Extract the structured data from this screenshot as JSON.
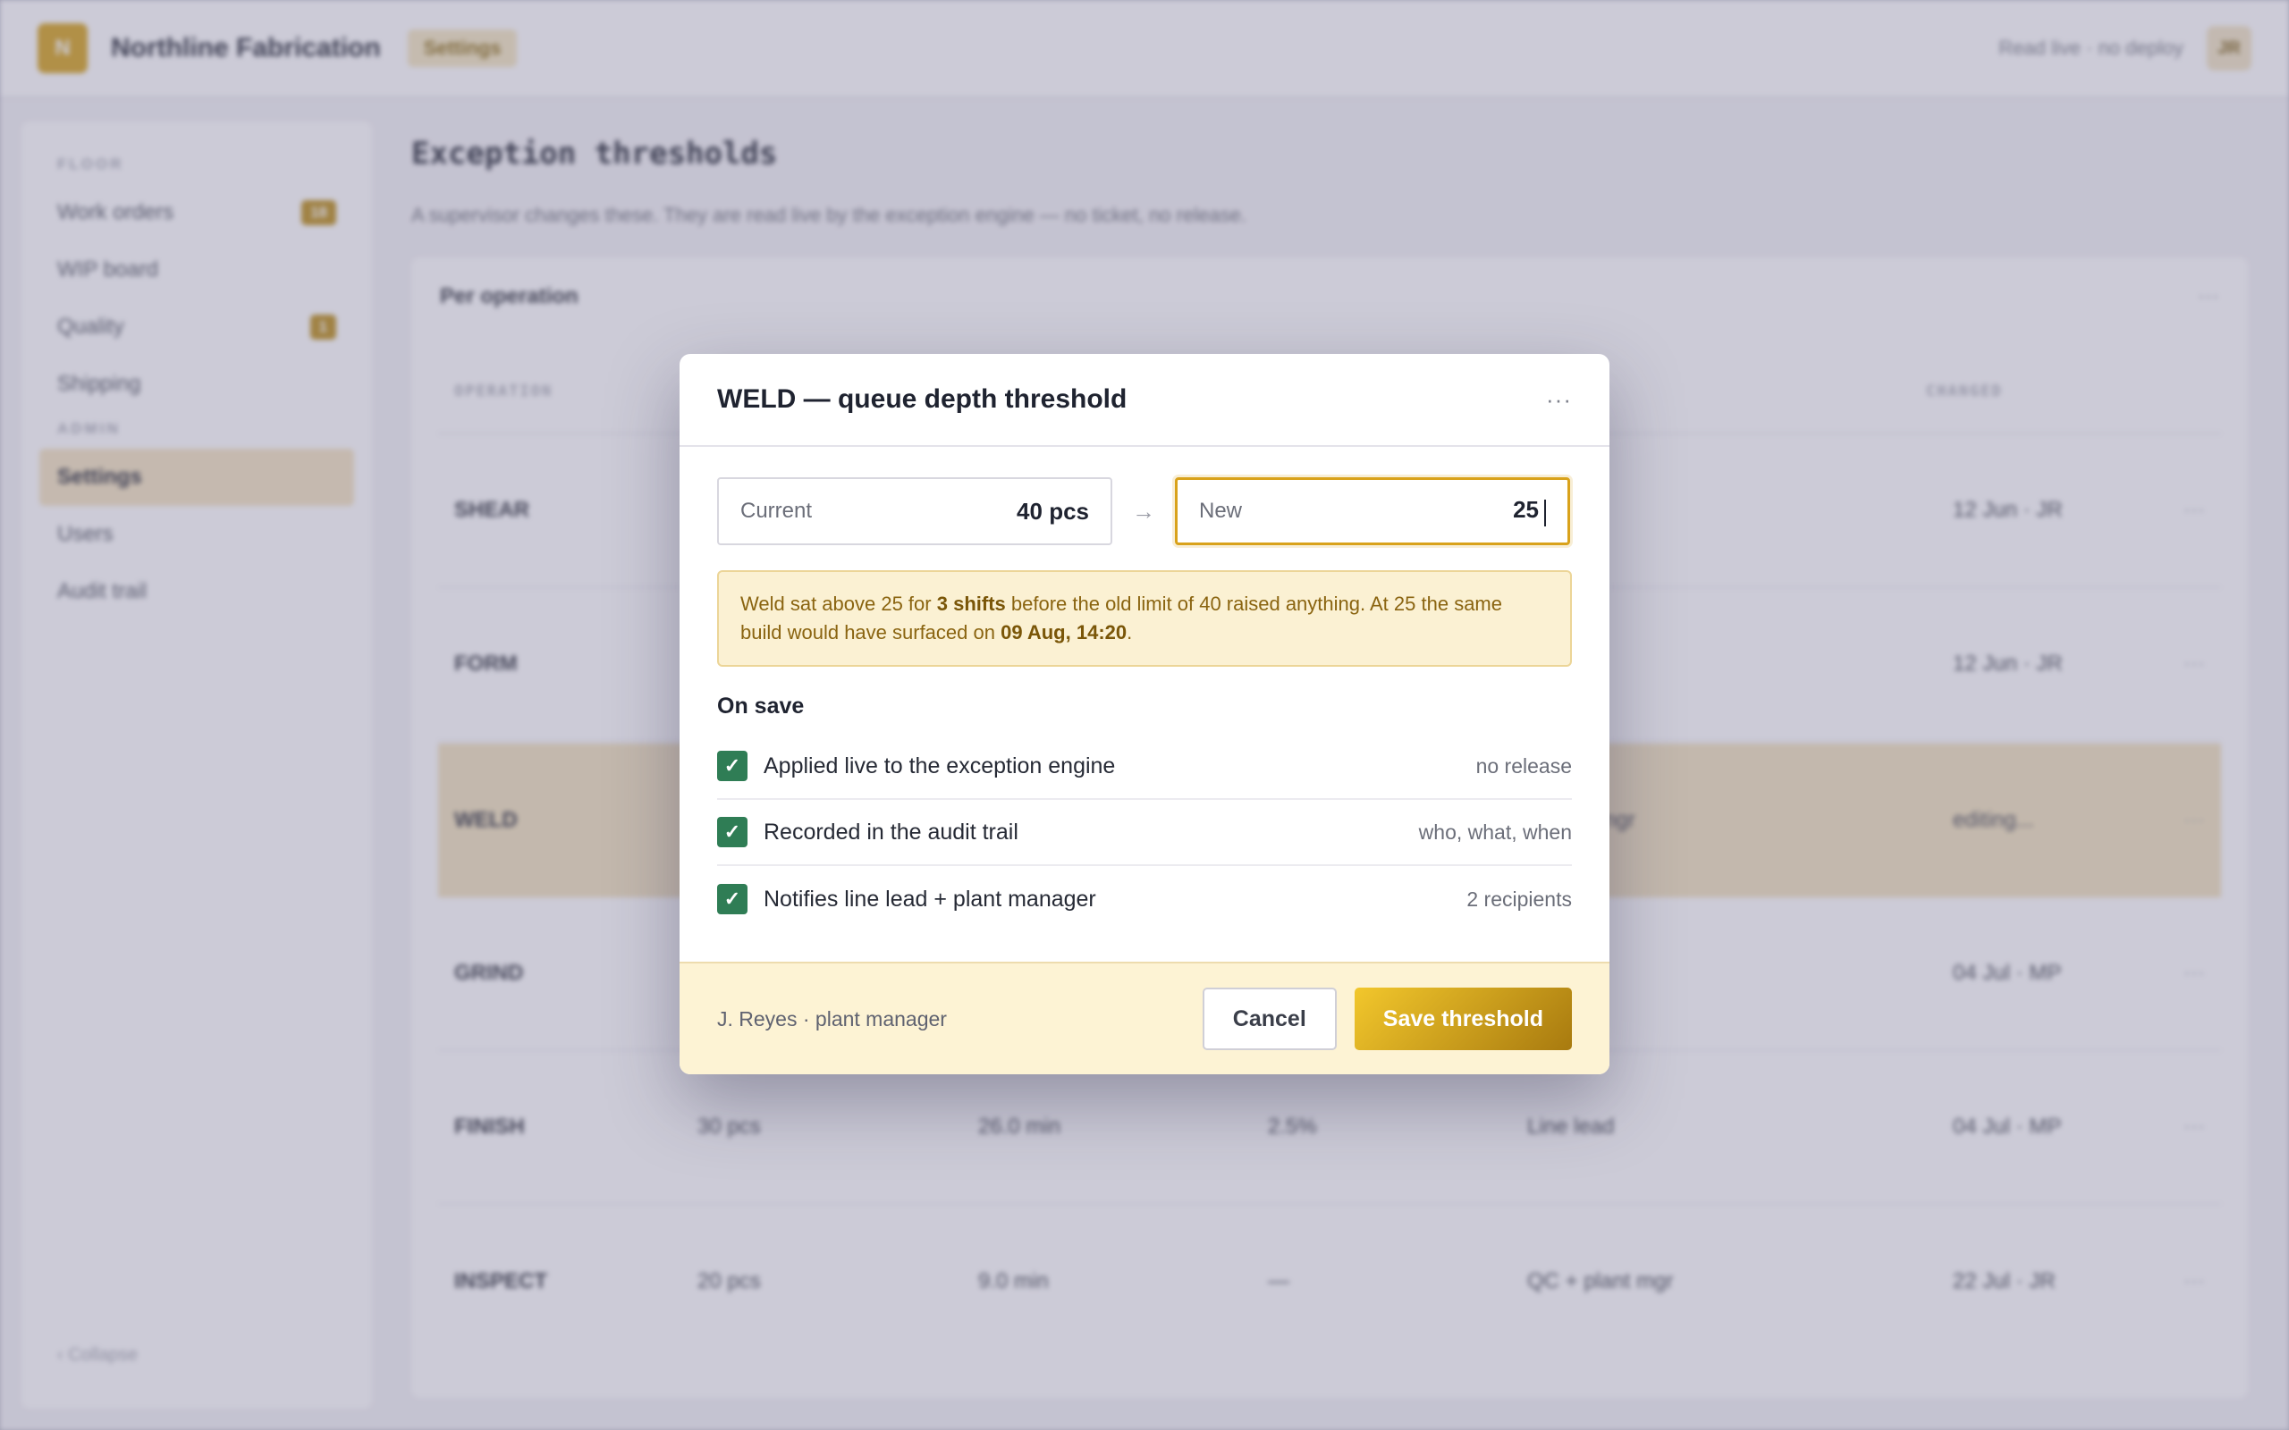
{
  "app": {
    "logo_text": "N",
    "name": "Northline Fabrication",
    "breadcrumb": "Settings",
    "status": "Read live · no deploy",
    "user_initials": "JR"
  },
  "sidebar": {
    "sections": [
      {
        "label": "FLOOR",
        "items": [
          {
            "label": "Work orders",
            "badge": "18"
          },
          {
            "label": "WIP board"
          },
          {
            "label": "Quality",
            "badge": "1"
          },
          {
            "label": "Shipping"
          }
        ]
      },
      {
        "label": "ADMIN",
        "items": [
          {
            "label": "Settings",
            "active": true
          },
          {
            "label": "Users"
          },
          {
            "label": "Audit trail"
          }
        ]
      }
    ],
    "collapse": "‹ Collapse"
  },
  "page": {
    "title": "Exception thresholds",
    "subtitle": "A supervisor changes these. They are read live by the exception engine — no ticket, no release.",
    "card_title": "Per operation",
    "card_menu": "···",
    "columns": {
      "operation": "OPERATION",
      "changed": "CHANGED"
    },
    "rows": [
      {
        "op": "SHEAR",
        "c1": "",
        "c2": "",
        "c3": "",
        "c4": "",
        "changed": "12 Jun · JR"
      },
      {
        "op": "FORM",
        "c1": "",
        "c2": "",
        "c3": "",
        "c4": "",
        "changed": "12 Jun · JR"
      },
      {
        "op": "WELD",
        "c1": "",
        "c2": "",
        "c3": "",
        "c4": "+ plant mgr",
        "changed": "editing...",
        "highlight": true
      },
      {
        "op": "GRIND",
        "c1": "",
        "c2": "",
        "c3": "",
        "c4": "",
        "changed": "04 Jul · MP"
      },
      {
        "op": "FINISH",
        "c1": "30 pcs",
        "c2": "26.0 min",
        "c3": "2.5%",
        "c4": "Line lead",
        "changed": "04 Jul · MP"
      },
      {
        "op": "INSPECT",
        "c1": "20 pcs",
        "c2": "9.0 min",
        "c3": "—",
        "c4": "QC + plant mgr",
        "changed": "22 Jul · JR"
      }
    ],
    "row_menu": "···"
  },
  "modal": {
    "title": "WELD — queue depth threshold",
    "menu": "···",
    "current_label": "Current",
    "current_value": "40 pcs",
    "arrow": "→",
    "new_label": "New",
    "new_value": "25",
    "notice": {
      "p1": "Weld sat above 25 for ",
      "b1": "3 shifts",
      "p2": " before the old limit of 40 raised anything. At 25 the same build would have surfaced on ",
      "b2": "09 Aug, 14:20",
      "p3": "."
    },
    "on_save_heading": "On save",
    "checks": [
      {
        "label": "Applied live to the exception engine",
        "note": "no release"
      },
      {
        "label": "Recorded in the audit trail",
        "note": "who, what, when"
      },
      {
        "label": "Notifies line lead + plant manager",
        "note": "2 recipients"
      }
    ],
    "checkmark": "✓",
    "footer_user": "J. Reyes · plant manager",
    "cancel_label": "Cancel",
    "save_label": "Save threshold"
  },
  "colors": {
    "accent": "#d9a21b",
    "check": "#2f7d55",
    "notice_bg": "#fbf1d3",
    "footer_bg": "#fdf3d4"
  }
}
